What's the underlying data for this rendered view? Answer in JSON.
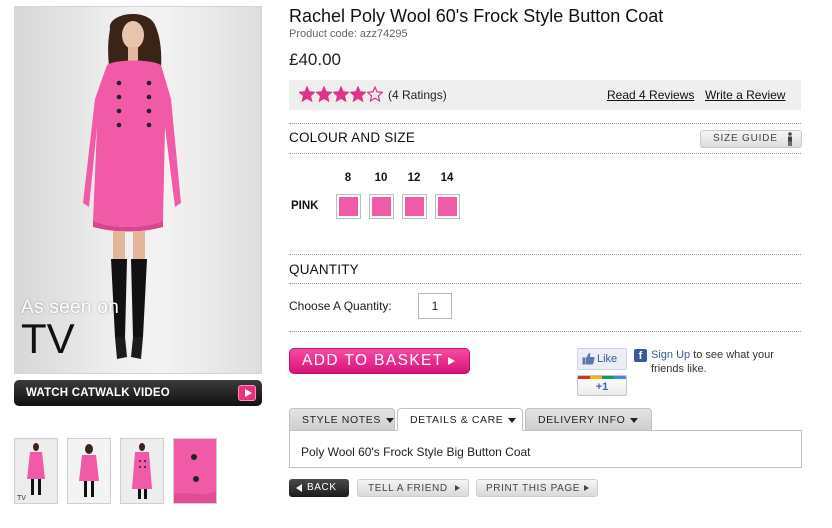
{
  "product": {
    "title": "Rachel Poly Wool 60's Frock Style Button Coat",
    "code": "Product code: azz74295",
    "price": "£40.00"
  },
  "media": {
    "as_seen_on_line1": "As seen on",
    "as_seen_on_line2": "TV",
    "catwalk_label": "WATCH CATWALK VIDEO",
    "thumb_tv_label": "TV",
    "coat_color": "#f05aa6"
  },
  "rating": {
    "stars_filled": 4,
    "stars_total": 5,
    "count_label": "(4 Ratings)",
    "read_reviews": "Read 4 Reviews",
    "write_review": "Write a Review",
    "star_color": "#e0338a"
  },
  "colour_size": {
    "heading": "COLOUR AND SIZE",
    "size_guide": "SIZE GUIDE",
    "sizes": [
      "8",
      "10",
      "12",
      "14"
    ],
    "colour": "PINK",
    "swatch_color": "#f05aa6"
  },
  "quantity": {
    "heading": "QUANTITY",
    "label": "Choose A Quantity:",
    "value": "1"
  },
  "basket": {
    "label": "ADD TO BASKET"
  },
  "social": {
    "like": "Like",
    "gplus": "+1",
    "fb_signup": "Sign Up",
    "fb_text": " to see what your friends like."
  },
  "tabs": [
    {
      "label": "STYLE NOTES"
    },
    {
      "label": "DETAILS & CARE"
    },
    {
      "label": "DELIVERY INFO"
    }
  ],
  "tab_content": "Poly Wool 60's Frock Style Big Button Coat",
  "actions": {
    "back": "BACK",
    "tell": "TELL A FRIEND",
    "print": "PRINT THIS PAGE"
  }
}
